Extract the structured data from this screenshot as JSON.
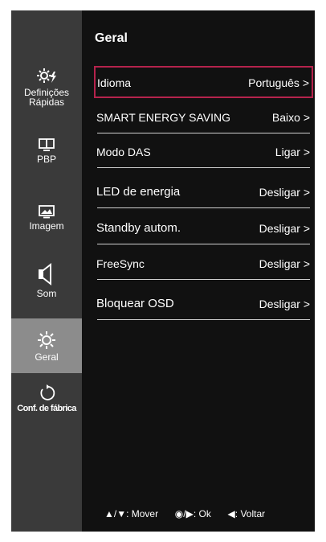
{
  "sidebar": {
    "items": [
      {
        "label_line1": "Definições",
        "label_line2": "Rápidas",
        "icon": "quick-settings-icon",
        "active": false
      },
      {
        "label": "PBP",
        "icon": "pbp-icon",
        "active": false
      },
      {
        "label": "Imagem",
        "icon": "picture-icon",
        "active": false
      },
      {
        "label": "Som",
        "icon": "speaker-icon",
        "active": false
      },
      {
        "label": "Geral",
        "icon": "gear-icon",
        "active": true
      },
      {
        "label": "Conf. de fábrica",
        "icon": "reset-icon",
        "active": false
      }
    ]
  },
  "panel": {
    "title": "Geral",
    "rows": [
      {
        "name": "Idioma",
        "value": "Português >",
        "selected": true
      },
      {
        "name": "SMART ENERGY SAVING",
        "value": "Baixo >"
      },
      {
        "name": "Modo DAS",
        "value": "Ligar >"
      },
      {
        "name": "LED de energia",
        "value": "Desligar >"
      },
      {
        "name": "Standby autom.",
        "value": "Desligar >"
      },
      {
        "name": "FreeSync",
        "value": "Desligar >"
      },
      {
        "name": "Bloquear OSD",
        "value": "Desligar >"
      }
    ]
  },
  "footer": {
    "move_keys": "▲/▼:",
    "move": "Mover",
    "ok_keys": "◉/▶:",
    "ok": "Ok",
    "back_keys": "◀:",
    "back": "Voltar"
  },
  "colors": {
    "background": "#111111",
    "sidebar": "#3a3a3a",
    "active_item": "#8c8c8c",
    "selection_border": "#b5234c"
  }
}
